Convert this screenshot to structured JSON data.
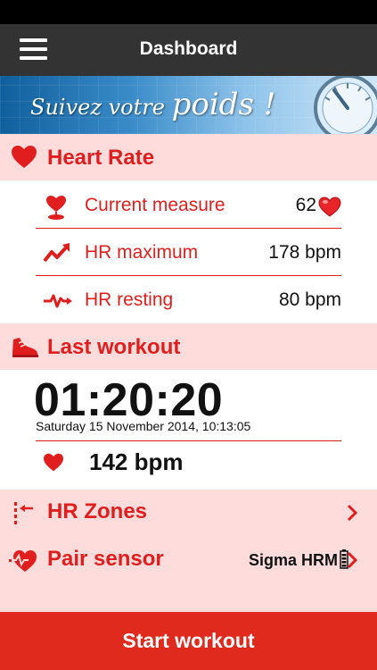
{
  "nav": {
    "title": "Dashboard",
    "menu_icon": "hamburger-menu-icon"
  },
  "banner": {
    "text_small": "Suivez votre",
    "text_big": "poids !",
    "icon": "scale-icon"
  },
  "heart_rate": {
    "title": "Heart Rate",
    "icon": "heart-icon",
    "rows": [
      {
        "label": "Current measure",
        "value": "62",
        "icon": "heart-pin-icon"
      },
      {
        "label": "HR maximum",
        "value": "178 bpm",
        "icon": "trend-up-icon"
      },
      {
        "label": "HR resting",
        "value": "80 bpm",
        "icon": "heartbeat-line-icon"
      }
    ]
  },
  "last_workout": {
    "title": "Last workout",
    "icon": "running-shoe-icon",
    "duration": "01:20:20",
    "datetime": "Saturday 15 November 2014, 10:13:05",
    "bpm": "142 bpm"
  },
  "hr_zones": {
    "label": "HR Zones",
    "icon": "zones-icon"
  },
  "pair_sensor": {
    "label": "Pair sensor",
    "value": "Sigma HRM",
    "icon": "sensor-heart-icon",
    "battery_icon": "battery-icon"
  },
  "start_button": {
    "label": "Start workout"
  },
  "colors": {
    "accent": "#e01e1e",
    "header_bg": "#fedcdc",
    "nav_bg": "#333333",
    "button_bg": "#e02a1e"
  }
}
